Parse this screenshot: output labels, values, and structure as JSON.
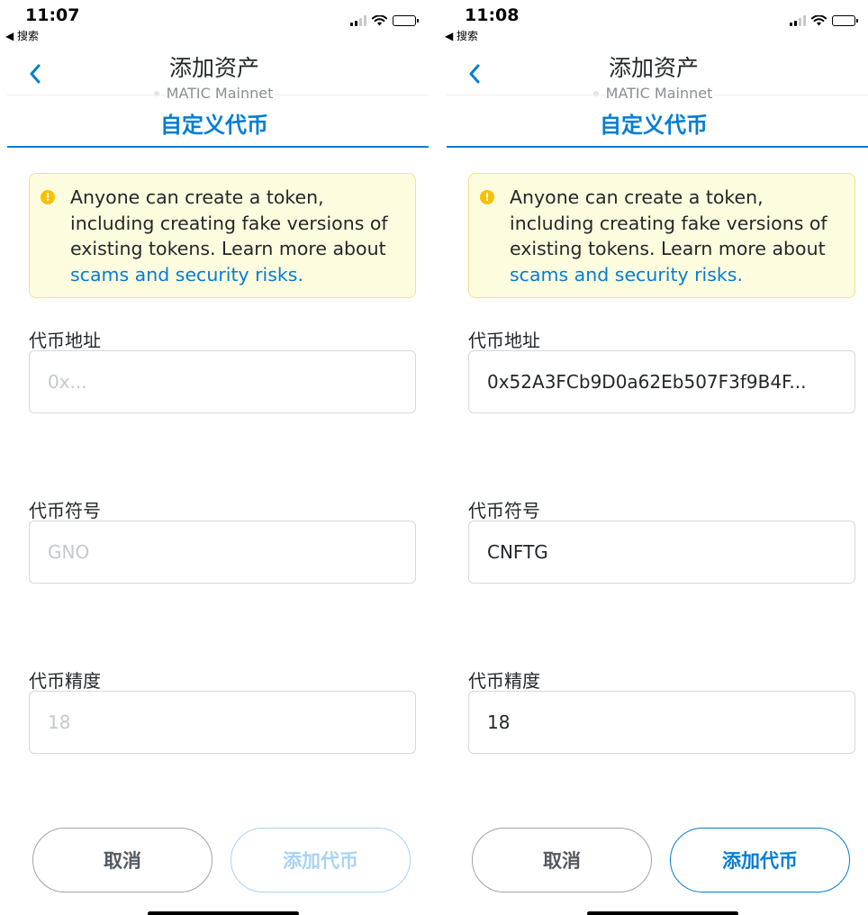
{
  "screens": [
    {
      "status": {
        "time": "11:07",
        "back_app": "◀ 搜索"
      },
      "header": {
        "title": "添加资产",
        "network": "MATIC Mainnet",
        "tab": "自定义代币"
      },
      "warning": {
        "text": "Anyone can create a token, including creating fake versions of existing tokens. Learn more about ",
        "link": "scams and security risks."
      },
      "fields": {
        "address": {
          "label": "代币地址",
          "value": "",
          "placeholder": "0x..."
        },
        "symbol": {
          "label": "代币符号",
          "value": "",
          "placeholder": "GNO"
        },
        "decimals": {
          "label": "代币精度",
          "value": "",
          "placeholder": "18"
        }
      },
      "buttons": {
        "cancel": "取消",
        "add": "添加代币",
        "add_state": "disabled"
      }
    },
    {
      "status": {
        "time": "11:08",
        "back_app": "◀ 搜索"
      },
      "header": {
        "title": "添加资产",
        "network": "MATIC Mainnet",
        "tab": "自定义代币"
      },
      "warning": {
        "text": "Anyone can create a token, including creating fake versions of existing tokens. Learn more about ",
        "link": "scams and security risks."
      },
      "fields": {
        "address": {
          "label": "代币地址",
          "value": "0x52A3FCb9D0a62Eb507F3f9B4F...",
          "placeholder": "0x..."
        },
        "symbol": {
          "label": "代币符号",
          "value": "CNFTG",
          "placeholder": "GNO"
        },
        "decimals": {
          "label": "代币精度",
          "value": "18",
          "placeholder": "18"
        }
      },
      "buttons": {
        "cancel": "取消",
        "add": "添加代币",
        "add_state": "enabled"
      }
    }
  ],
  "colors": {
    "accent": "#037dd6",
    "accent_disabled": "#a9d3f2",
    "warning_bg": "#fefcde",
    "warning_border": "#f2e28c",
    "warning_icon": "#f8c000"
  },
  "icons": {
    "back": "chevron-left-icon",
    "warning": "exclamation-circle-icon",
    "signal": "cellular-signal-icon",
    "wifi": "wifi-icon",
    "battery": "battery-icon"
  }
}
